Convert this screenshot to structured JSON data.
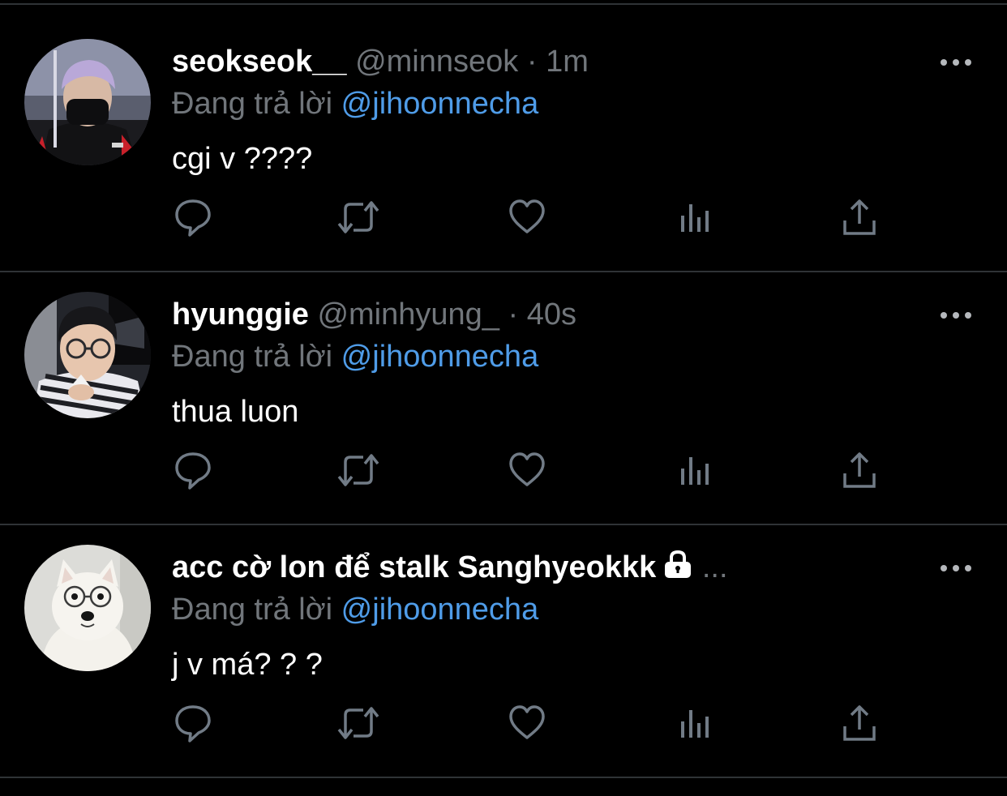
{
  "tweets": [
    {
      "display_name": "seokseok__",
      "handle": "@minnseok",
      "separator": "·",
      "time": "1m",
      "reply_prefix": "Đang trả lời",
      "reply_to": "@jihoonnecha",
      "text": "cgi v ????",
      "avatar": "avatar-masked-man"
    },
    {
      "display_name": "hyunggie",
      "handle": "@minhyung_",
      "separator": "·",
      "time": "40s",
      "reply_prefix": "Đang trả lời",
      "reply_to": "@jihoonnecha",
      "text": "thua luon",
      "avatar": "avatar-man-glasses"
    },
    {
      "display_name": "acc cờ lon để stalk Sanghyeokkk",
      "locked": true,
      "truncated": "...",
      "reply_prefix": "Đang trả lời",
      "reply_to": "@jihoonnecha",
      "text": "j v má? ? ?",
      "avatar": "avatar-white-dog"
    }
  ],
  "icons": {
    "reply": "reply-icon",
    "retweet": "retweet-icon",
    "like": "like-icon",
    "analytics": "analytics-icon",
    "share": "share-icon",
    "more": "more-icon",
    "lock": "lock-icon"
  },
  "colors": {
    "background": "#000000",
    "text": "#ffffff",
    "muted": "#71767b",
    "link": "#4f9ce8",
    "divider": "#2f3336"
  }
}
